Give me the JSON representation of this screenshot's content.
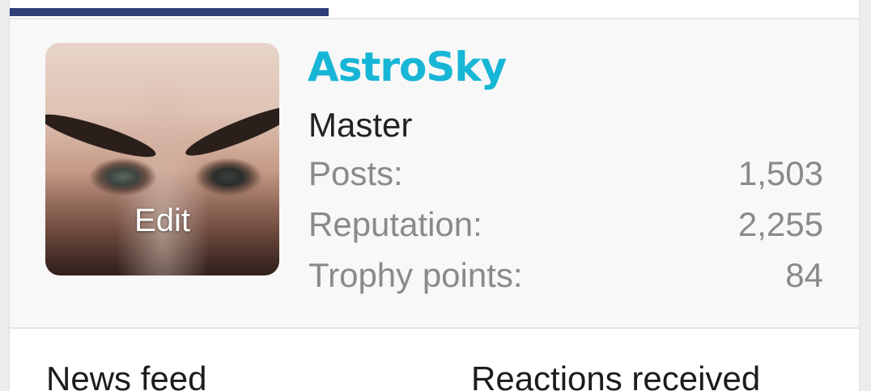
{
  "profile": {
    "username": "AstroSky",
    "user_title": "Master",
    "avatar_edit_label": "Edit",
    "stats": [
      {
        "label": "Posts:",
        "value": "1,503"
      },
      {
        "label": "Reputation:",
        "value": "2,255"
      },
      {
        "label": "Trophy points:",
        "value": "84"
      }
    ]
  },
  "tabs": [
    {
      "label": "News feed"
    },
    {
      "label": "Reactions received"
    }
  ],
  "colors": {
    "accent": "#17b6d6",
    "tab_indicator": "#2f3f78",
    "stat_text": "#8a8a8a"
  }
}
